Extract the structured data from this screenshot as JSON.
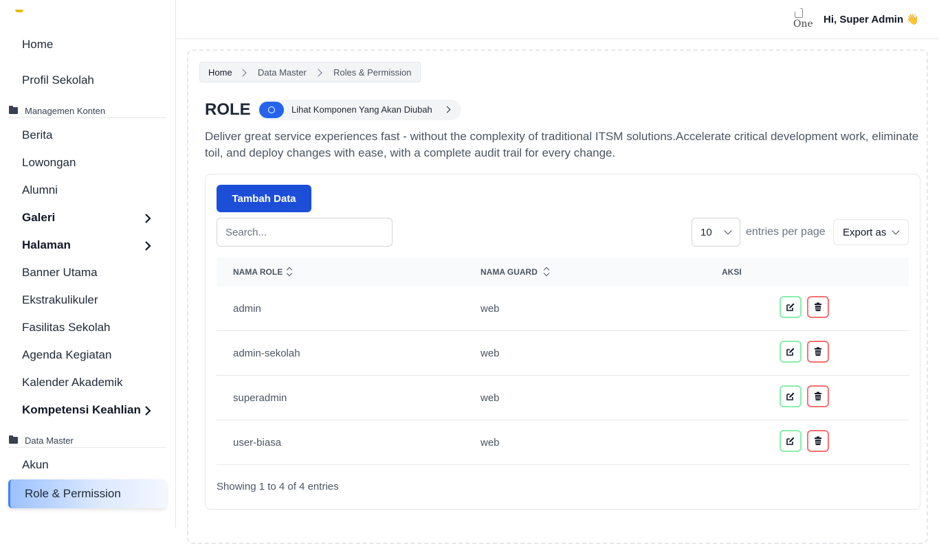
{
  "sidebar": {
    "items": [
      {
        "label": "Home"
      },
      {
        "label": "Profil Sekolah"
      },
      {
        "label": "Berita"
      },
      {
        "label": "Lowongan"
      },
      {
        "label": "Alumni"
      },
      {
        "label": "Galeri",
        "has_submenu": true
      },
      {
        "label": "Halaman",
        "has_submenu": true
      },
      {
        "label": "Banner Utama"
      },
      {
        "label": "Ekstrakulikuler"
      },
      {
        "label": "Fasilitas Sekolah"
      },
      {
        "label": "Agenda Kegiatan"
      },
      {
        "label": "Kalender Akademik"
      },
      {
        "label": "Kompetensi Keahlian",
        "has_submenu": true
      },
      {
        "label": "Akun"
      },
      {
        "label": "Role & Permission",
        "active": true
      }
    ],
    "sections": [
      "Managemen Konten",
      "Data Master"
    ]
  },
  "header": {
    "avatar_alt": "One",
    "greeting": "Hi, Super Admin 👋"
  },
  "breadcrumb": [
    "Home",
    "Data Master",
    "Roles & Permission"
  ],
  "page": {
    "title": "ROLE",
    "pill_label": "Lihat Komponen Yang Akan Diubah",
    "description": "Deliver great service experiences fast - without the complexity of traditional ITSM solutions.Accelerate critical development work, eliminate toil, and deploy changes with ease, with a complete audit trail for every change."
  },
  "toolbar": {
    "add_label": "Tambah Data",
    "search_placeholder": "Search...",
    "entries_value": "10",
    "entries_label": "entries per page",
    "export_label": "Export as"
  },
  "table": {
    "columns": [
      "NAMA ROLE",
      "NAMA GUARD",
      "AKSI"
    ],
    "rows": [
      {
        "role": "admin",
        "guard": "web"
      },
      {
        "role": "admin-sekolah",
        "guard": "web"
      },
      {
        "role": "superadmin",
        "guard": "web"
      },
      {
        "role": "user-biasa",
        "guard": "web"
      }
    ],
    "info": "Showing 1 to 4 of 4 entries"
  },
  "colors": {
    "primary": "#1d4ed8",
    "edit_border": "#86efac",
    "delete_border": "#f87171",
    "active_nav": "#9cc1ff"
  }
}
